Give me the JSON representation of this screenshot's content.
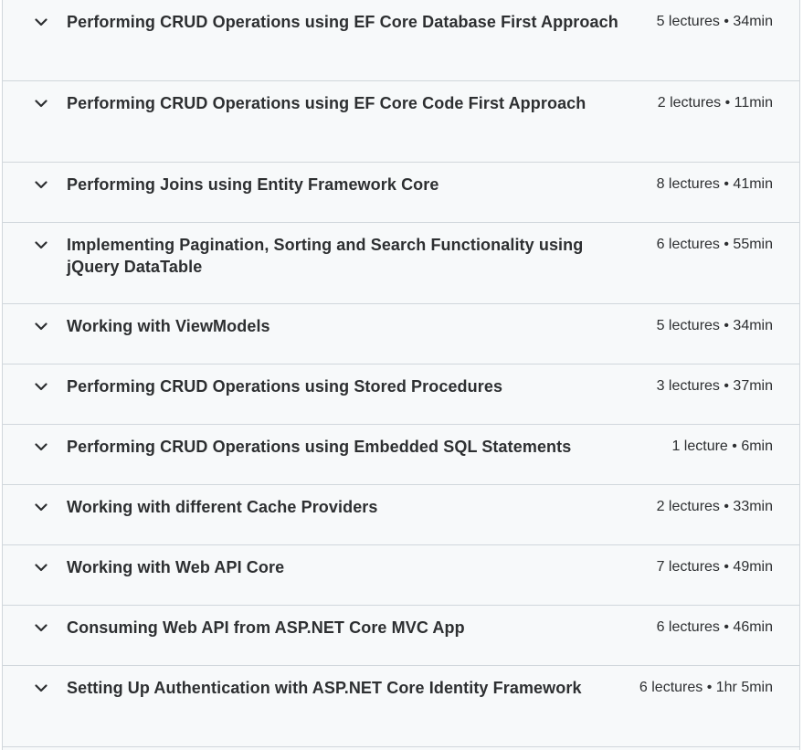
{
  "colors": {
    "section_bg": "#f7f9fa",
    "border": "#d1d7dc",
    "text": "#2d2f31"
  },
  "icons": {
    "expand": "chevron-down-icon"
  },
  "sections": [
    {
      "title": "Performing CRUD Operations using EF Core Database First Approach",
      "meta": "5 lectures • 34min"
    },
    {
      "title": "Performing CRUD Operations using EF Core Code First Approach",
      "meta": "2 lectures • 11min"
    },
    {
      "title": "Performing Joins using Entity Framework Core",
      "meta": "8 lectures • 41min"
    },
    {
      "title": "Implementing Pagination, Sorting and Search Functionality using jQuery DataTable",
      "meta": "6 lectures • 55min"
    },
    {
      "title": "Working with ViewModels",
      "meta": "5 lectures • 34min"
    },
    {
      "title": "Performing CRUD Operations using Stored Procedures",
      "meta": "3 lectures • 37min"
    },
    {
      "title": "Performing CRUD Operations using Embedded SQL Statements",
      "meta": "1 lecture • 6min"
    },
    {
      "title": "Working with different Cache Providers",
      "meta": "2 lectures • 33min"
    },
    {
      "title": "Working with Web API Core",
      "meta": "7 lectures • 49min"
    },
    {
      "title": "Consuming Web API from ASP.NET Core MVC App",
      "meta": "6 lectures • 46min"
    },
    {
      "title": "Setting Up Authentication with ASP.NET Core Identity Framework",
      "meta": "6 lectures • 1hr 5min"
    }
  ]
}
